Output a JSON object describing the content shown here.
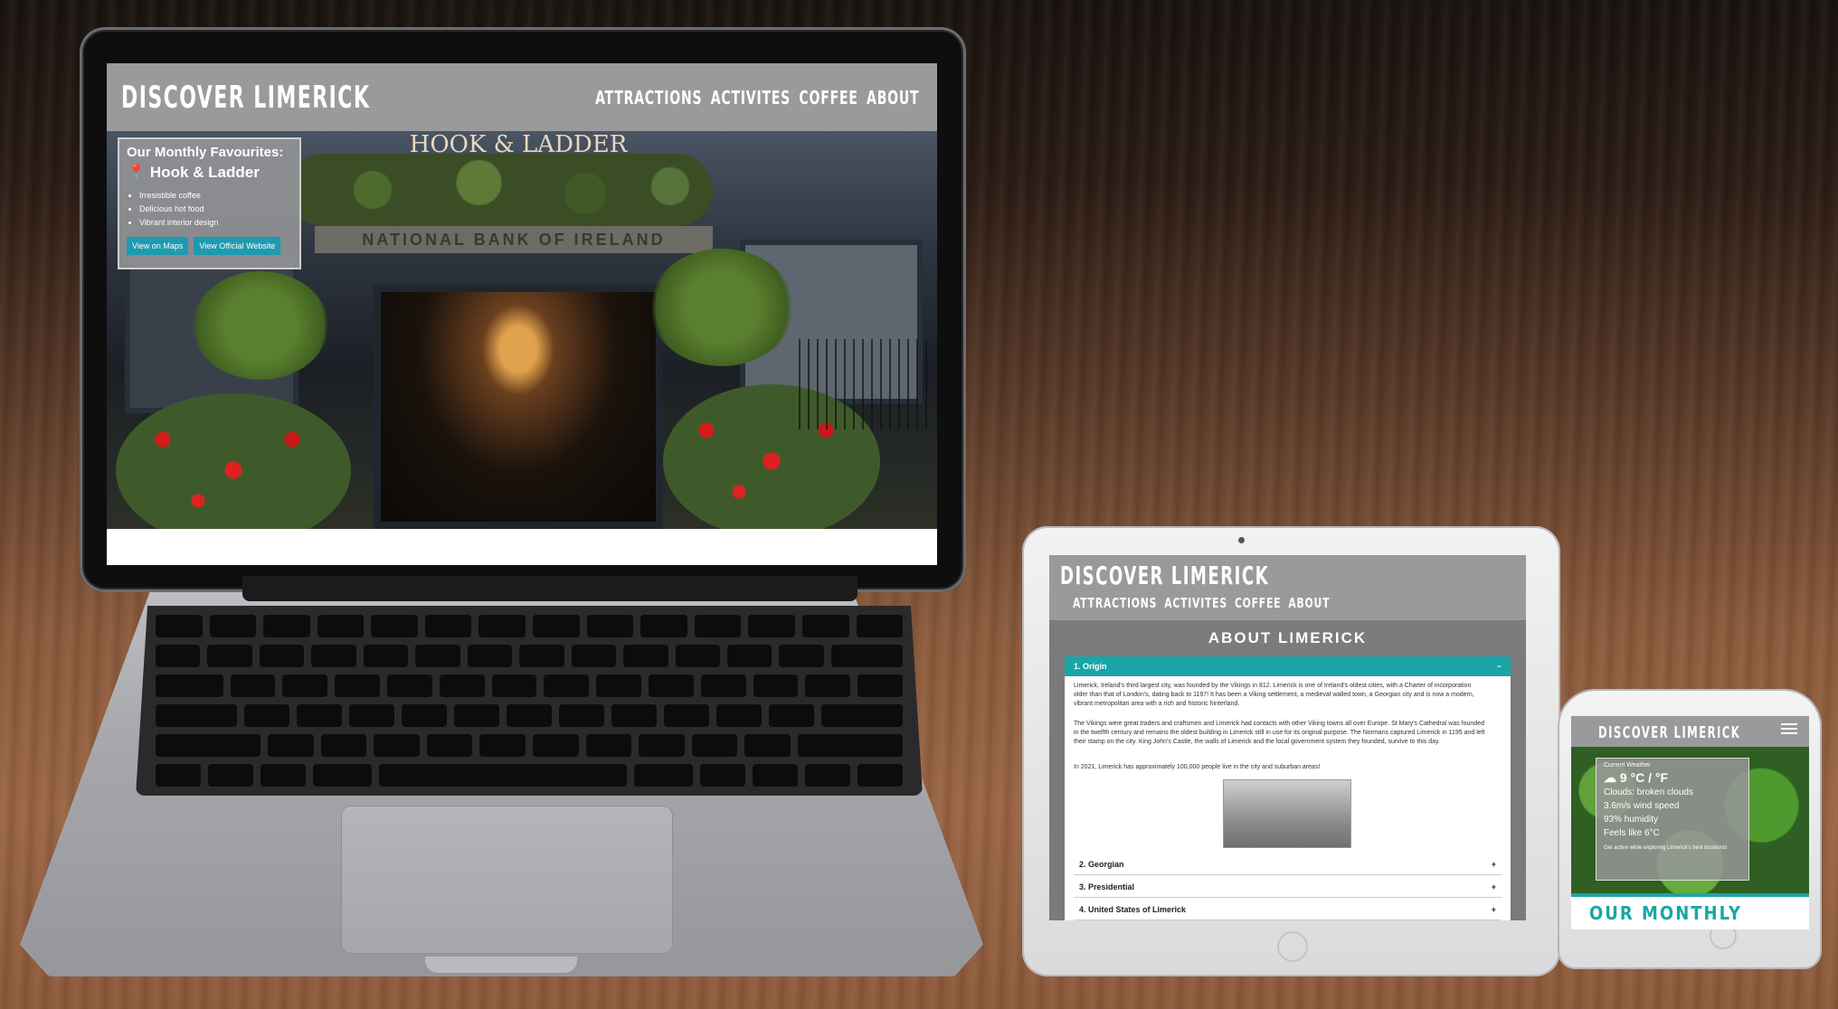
{
  "laptop": {
    "nav": {
      "title": "DISCOVER LIMERICK",
      "links": [
        "ATTRACTIONS",
        "ACTIVITES",
        "COFFEE",
        "ABOUT"
      ]
    },
    "hero": {
      "sign_text": "HOOK & LADDER",
      "bank_text": "NATIONAL BANK OF IRELAND"
    },
    "favourites": {
      "heading": "Our Monthly Favourites:",
      "name": "Hook & Ladder",
      "pin_icon": "map-pin-icon",
      "bullets": [
        "Irresistible coffee",
        "Delicious hot food",
        "Vibrant interior design"
      ],
      "buttons": [
        "View on Maps",
        "View Official Website"
      ]
    }
  },
  "tablet": {
    "nav": {
      "title": "DISCOVER LIMERICK",
      "links": [
        "ATTRACTIONS",
        "ACTIVITES",
        "COFFEE",
        "ABOUT"
      ]
    },
    "section_title": "ABOUT LIMERICK",
    "accordion_open": {
      "label": "1. Origin",
      "toggle": "−"
    },
    "paragraphs": [
      "Limerick, Ireland's third largest city, was founded by the Vikings in 812. Limerick is one of Ireland's oldest cities, with a Charter of incorporation older than that of London's, dating back to 1197! It has been a Viking settlement, a medieval walled town, a Georgian city and is now a modern, vibrant metropolitan area with a rich and historic hinterland.",
      "The Vikings were great traders and craftsmen and Limerick had contacts with other Viking towns all over Europe. St Mary's Cathedral was founded in the twelfth century and remains the oldest building in Limerick still in use for its original purpose. The Normans captured Limerick in 1195 and left their stamp on the city. King John's Castle, the walls of Limerick and the local government system they founded, survive to this day.",
      "In 2021, Limerick has approximately 100,000 people live in the city and suburban areas!"
    ],
    "accordions": [
      {
        "label": "2. Georgian",
        "toggle": "+"
      },
      {
        "label": "3. Presidential",
        "toggle": "+"
      },
      {
        "label": "4. United States of Limerick",
        "toggle": "+"
      }
    ]
  },
  "phone": {
    "nav": {
      "title": "DISCOVER LIMERICK"
    },
    "weather": {
      "heading": "Current Weather",
      "temp": "9 °C / °F",
      "lines": [
        "Clouds: broken clouds",
        "3.6m/s wind speed",
        "93% humidity",
        "Feels like 6°C"
      ],
      "footnote": "Get active while exploring Limerick's best locations!"
    },
    "monthly_heading": "OUR MONTHLY"
  },
  "colors": {
    "nav_gray": "#9a9a9c",
    "accent_teal": "#1aa6a6",
    "button_blue": "#1c9bb0"
  }
}
